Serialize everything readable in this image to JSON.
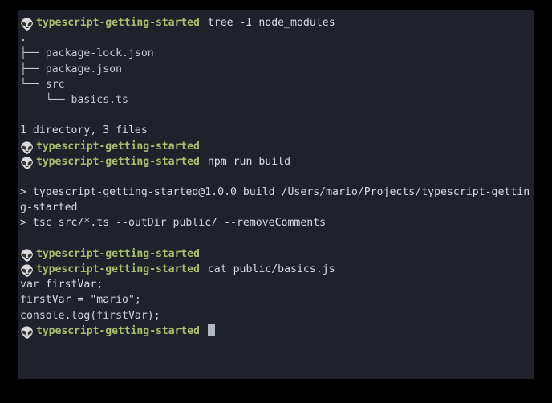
{
  "window": {
    "background": "#000000",
    "terminal_background": "#1f222b",
    "prompt_color": "#a9be6e",
    "text_color": "#d6dbe3",
    "cursor_color": "#b2b8c3"
  },
  "prompt": {
    "icon": "alien-icon",
    "glyph": "👽",
    "name": "typescript-getting-started"
  },
  "lines": [
    {
      "kind": "prompt",
      "command": "tree -I node_modules"
    },
    {
      "kind": "output",
      "text": "."
    },
    {
      "kind": "output",
      "text": "├── package-lock.json"
    },
    {
      "kind": "output",
      "text": "├── package.json"
    },
    {
      "kind": "output",
      "text": "└── src"
    },
    {
      "kind": "output",
      "text": "    └── basics.ts"
    },
    {
      "kind": "blank",
      "text": ""
    },
    {
      "kind": "output",
      "text": "1 directory, 3 files"
    },
    {
      "kind": "prompt",
      "command": ""
    },
    {
      "kind": "prompt",
      "command": "npm run build"
    },
    {
      "kind": "blank",
      "text": ""
    },
    {
      "kind": "output",
      "text": "> typescript-getting-started@1.0.0 build /Users/mario/Projects/typescript-gettin"
    },
    {
      "kind": "output",
      "text": "g-started"
    },
    {
      "kind": "output",
      "text": "> tsc src/*.ts --outDir public/ --removeComments"
    },
    {
      "kind": "blank",
      "text": ""
    },
    {
      "kind": "prompt",
      "command": ""
    },
    {
      "kind": "prompt",
      "command": "cat public/basics.js"
    },
    {
      "kind": "output",
      "text": "var firstVar;"
    },
    {
      "kind": "output",
      "text": "firstVar = \"mario\";"
    },
    {
      "kind": "output",
      "text": "console.log(firstVar);"
    },
    {
      "kind": "prompt-cursor",
      "command": ""
    }
  ]
}
